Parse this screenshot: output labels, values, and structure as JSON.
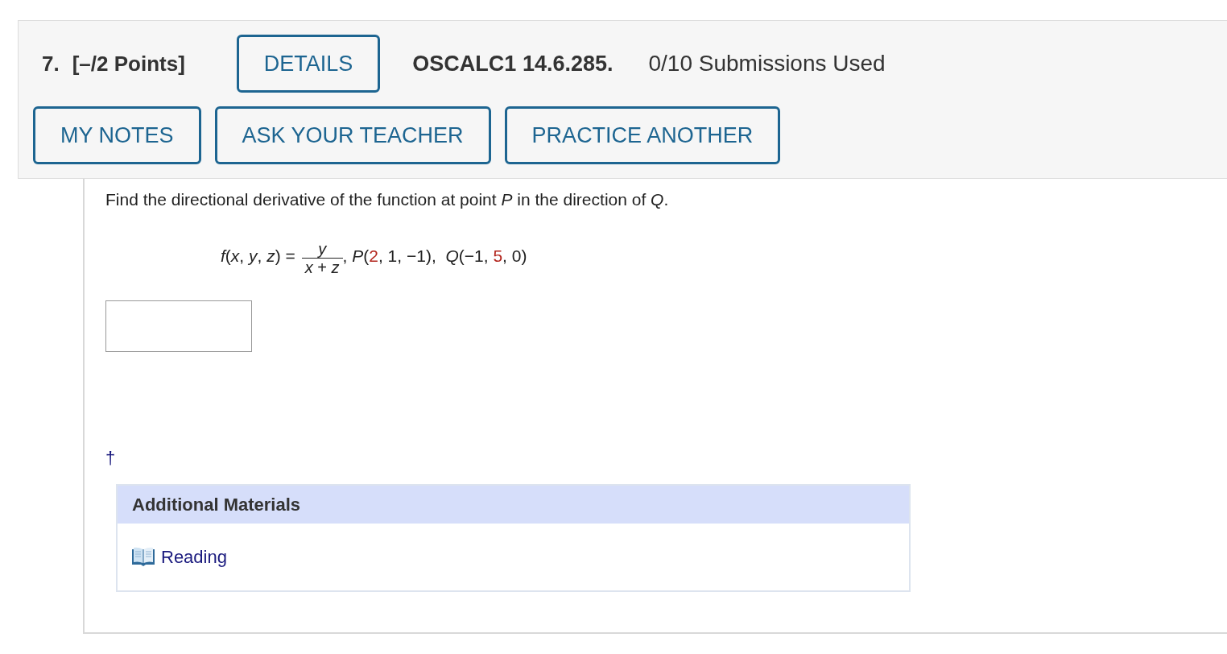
{
  "header": {
    "number": "7.",
    "points": "[–/2 Points]",
    "details_button": "DETAILS",
    "code": "OSCALC1 14.6.285.",
    "submissions": "0/10 Submissions Used"
  },
  "buttons": [
    "MY NOTES",
    "ASK YOUR TEACHER",
    "PRACTICE ANOTHER"
  ],
  "question": {
    "prompt": "Find the directional derivative of the function at point *P* in the direction of *Q*.",
    "formula": {
      "lhs": "*f*(*x*, *y*, *z*) =",
      "numerator": "*y*",
      "denominator": "*x* + *z*",
      "rest": [
        {
          "text": ", *P*(",
          "color": "#222222"
        },
        {
          "text": "2",
          "color": "#b3261e"
        },
        {
          "text": ", 1, −1),  *Q*(−1, ",
          "color": "#222222"
        },
        {
          "text": "5",
          "color": "#b3261e"
        },
        {
          "text": ", 0)",
          "color": "#222222"
        }
      ]
    }
  },
  "footnote_mark": "†",
  "additional_materials": {
    "title": "Additional Materials",
    "links": [
      {
        "label": "Reading"
      }
    ]
  }
}
